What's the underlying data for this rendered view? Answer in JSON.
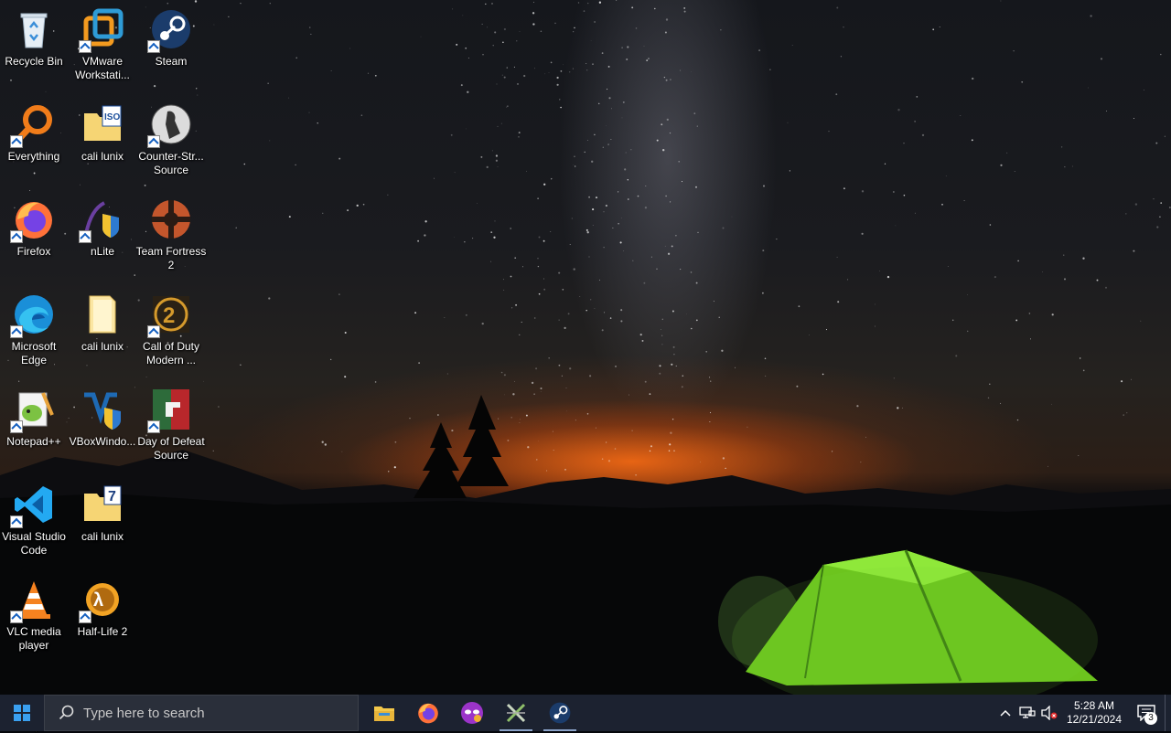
{
  "desktop": {
    "icons": [
      {
        "label": "Recycle Bin",
        "icon": "recycle-bin-icon"
      },
      {
        "label": "VMware Workstati...",
        "icon": "vmware-icon"
      },
      {
        "label": "Steam",
        "icon": "steam-icon"
      },
      {
        "label": "Everything",
        "icon": "everything-search-icon"
      },
      {
        "label": "cali lunix",
        "icon": "iso-folder-icon"
      },
      {
        "label": "Counter-Str... Source",
        "icon": "counter-strike-icon"
      },
      {
        "label": "Firefox",
        "icon": "firefox-icon"
      },
      {
        "label": "nLite",
        "icon": "nlite-icon"
      },
      {
        "label": "Team Fortress 2",
        "icon": "team-fortress-icon"
      },
      {
        "label": "Microsoft Edge",
        "icon": "edge-icon"
      },
      {
        "label": "cali lunix",
        "icon": "folder-icon"
      },
      {
        "label": "Call of Duty Modern ...",
        "icon": "call-of-duty-icon"
      },
      {
        "label": "Notepad++",
        "icon": "notepad-plus-plus-icon"
      },
      {
        "label": "VBoxWindo...",
        "icon": "virtualbox-icon"
      },
      {
        "label": "Day of Defeat Source",
        "icon": "day-of-defeat-icon"
      },
      {
        "label": "Visual Studio Code",
        "icon": "vscode-icon"
      },
      {
        "label": "cali lunix",
        "icon": "7zip-folder-icon"
      },
      {
        "label": "VLC media player",
        "icon": "vlc-icon"
      },
      {
        "label": "Half-Life 2",
        "icon": "half-life-icon"
      }
    ]
  },
  "taskbar": {
    "search_placeholder": "Type here to search",
    "pinned": [
      {
        "name": "File Explorer",
        "icon": "file-explorer-icon",
        "running": false
      },
      {
        "name": "Firefox",
        "icon": "firefox-icon",
        "running": false
      },
      {
        "name": "Tor/Privacy app",
        "icon": "mask-app-icon",
        "running": false
      },
      {
        "name": "Tool",
        "icon": "tools-icon",
        "running": true
      },
      {
        "name": "Steam",
        "icon": "steam-icon",
        "running": true
      }
    ],
    "clock": {
      "time": "5:28 AM",
      "date": "12/21/2024"
    },
    "notification_count": "3"
  },
  "colors": {
    "taskbar": "#1c2230",
    "accent": "#0078d7"
  }
}
